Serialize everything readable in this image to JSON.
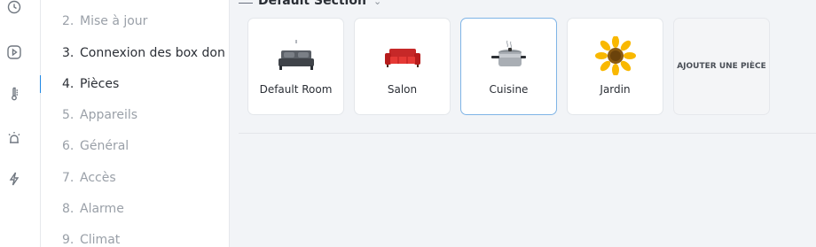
{
  "steps": [
    {
      "num": "2.",
      "label": "Mise à jour",
      "state": "done"
    },
    {
      "num": "3.",
      "label": "Connexion des box don",
      "state": "active-prev"
    },
    {
      "num": "4.",
      "label": "Pièces",
      "state": "active"
    },
    {
      "num": "5.",
      "label": "Appareils",
      "state": "pending"
    },
    {
      "num": "6.",
      "label": "Général",
      "state": "pending"
    },
    {
      "num": "7.",
      "label": "Accès",
      "state": "pending"
    },
    {
      "num": "8.",
      "label": "Alarme",
      "state": "pending"
    },
    {
      "num": "9.",
      "label": "Climat",
      "state": "pending"
    }
  ],
  "rail_icons": [
    "clock-icon",
    "play-icon",
    "thermometer-icon",
    "alarm-icon",
    "lightning-icon"
  ],
  "section": {
    "title": "Default Section"
  },
  "rooms": [
    {
      "label": "Default Room",
      "icon": "bed-icon"
    },
    {
      "label": "Salon",
      "icon": "sofa-icon"
    },
    {
      "label": "Cuisine",
      "icon": "pot-icon",
      "selected": true
    },
    {
      "label": "Jardin",
      "icon": "sunflower-icon"
    }
  ],
  "add_room_label": "AJOUTER UNE PIÈCE",
  "colors": {
    "accent": "#1e88e5",
    "selected_border": "#7fb4e6"
  }
}
